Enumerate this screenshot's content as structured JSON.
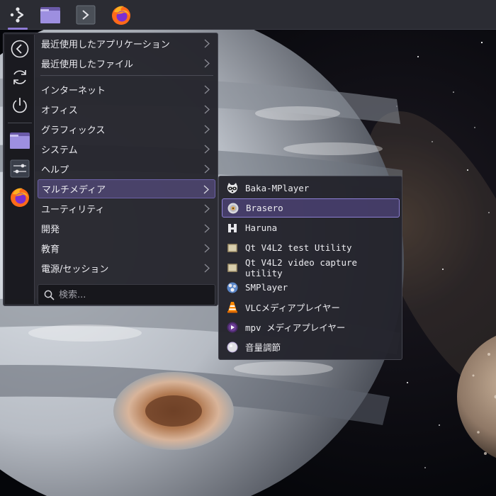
{
  "panel": {
    "launcher_icon": "kde-launcher-icon",
    "pinned": [
      {
        "name": "file-manager",
        "icon": "folder-icon"
      },
      {
        "name": "terminal",
        "icon": "terminal-icon"
      },
      {
        "name": "firefox",
        "icon": "firefox-icon"
      }
    ]
  },
  "menu": {
    "sidebar": [
      {
        "name": "back",
        "icon": "back-arrow-icon"
      },
      {
        "name": "refresh",
        "icon": "refresh-icon"
      },
      {
        "name": "power",
        "icon": "power-icon"
      },
      {
        "name": "file-manager",
        "icon": "folder-icon"
      },
      {
        "name": "settings",
        "icon": "settings-icon"
      },
      {
        "name": "firefox",
        "icon": "firefox-icon"
      }
    ],
    "categories": [
      {
        "label": "最近使用したアプリケーション"
      },
      {
        "label": "最近使用したファイル"
      },
      {
        "label": "インターネット"
      },
      {
        "label": "オフィス"
      },
      {
        "label": "グラフィックス"
      },
      {
        "label": "システム"
      },
      {
        "label": "ヘルプ"
      },
      {
        "label": "マルチメディア",
        "active": true
      },
      {
        "label": "ユーティリティ"
      },
      {
        "label": "開発"
      },
      {
        "label": "教育"
      },
      {
        "label": "電源/セッション"
      }
    ],
    "search_placeholder": "検索..."
  },
  "submenu": {
    "items": [
      {
        "label": "Baka-MPlayer",
        "icon": "raccoon-icon"
      },
      {
        "label": "Brasero",
        "icon": "disc-icon",
        "active": true
      },
      {
        "label": "Haruna",
        "icon": "haruna-icon"
      },
      {
        "label": "Qt V4L2 test Utility",
        "icon": "monitor-icon"
      },
      {
        "label": "Qt V4L2 video capture utility",
        "icon": "monitor-icon"
      },
      {
        "label": "SMPlayer",
        "icon": "smplayer-icon"
      },
      {
        "label": "VLCメディアプレイヤー",
        "icon": "vlc-cone-icon"
      },
      {
        "label": "mpv メディアプレイヤー",
        "icon": "mpv-icon"
      },
      {
        "label": "音量調節",
        "icon": "volume-icon"
      }
    ]
  },
  "colors": {
    "accent": "#8f7bd6",
    "panel_bg": "#2b2c33",
    "menu_bg": "#24242c"
  }
}
